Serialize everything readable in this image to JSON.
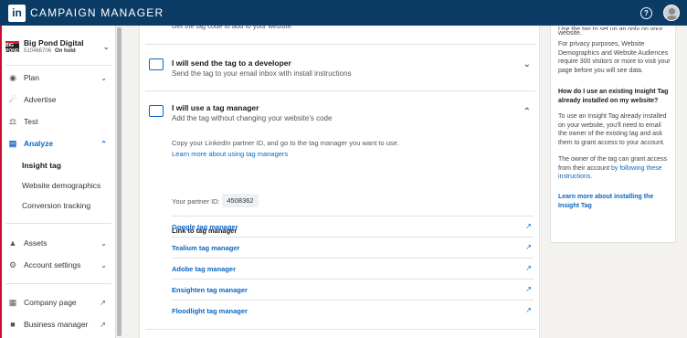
{
  "topbar": {
    "logo": "in",
    "title": "CAMPAIGN MANAGER",
    "help_glyph": "?"
  },
  "account": {
    "logo_text": "BIG POND",
    "name": "Big Pond Digital",
    "id": "510466706",
    "status": "On hold"
  },
  "sidebar": {
    "plan": "Plan",
    "advertise": "Advertise",
    "test": "Test",
    "analyze": "Analyze",
    "analyze_items": [
      "Insight tag",
      "Website demographics",
      "Conversion tracking"
    ],
    "assets": "Assets",
    "account_settings": "Account settings",
    "company_page": "Company page",
    "business_manager": "Business manager"
  },
  "main": {
    "cut_text": "Get the tag code to add to your website.",
    "option_developer": {
      "title": "I will send the tag to a developer",
      "desc": "Send the tag to your email inbox with install instructions"
    },
    "option_manager": {
      "title": "I will use a tag manager",
      "desc": "Add the tag without changing your website's code",
      "instructions": "Copy your LinkedIn partner ID, and go to the tag manager you want to use.",
      "learn_more": "Learn more about using tag managers",
      "partner_id_label": "Your partner ID:",
      "partner_id": "4508362",
      "link_header": "Link to tag manager",
      "managers": [
        "Google tag manager",
        "Tealium tag manager",
        "Adobe tag manager",
        "Ensighten tag manager",
        "Floodlight tag manager"
      ]
    }
  },
  "side_panel": {
    "cut_top": "Use the tag to set up an only on your",
    "line_website": "website.",
    "privacy": "For privacy purposes, Website Demographics and Website Audiences require 300 visitors or more to visit your page before you will see data.",
    "question": "How do I use an existing Insight Tag already installed on my website?",
    "answer": "To use an Insight Tag already installed on your website, you'll need to email the owner of the existing tag and ask them to grant access to your account.",
    "owner_text": "The owner of the tag can grant access from their account",
    "owner_link": "by following these instructions.",
    "learn_more": "Learn more about installing the Insight Tag"
  }
}
